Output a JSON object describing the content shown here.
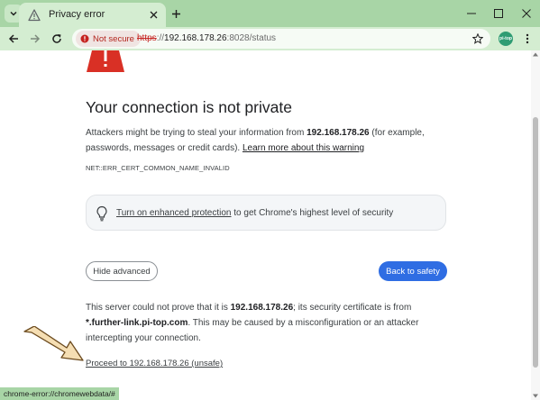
{
  "tab": {
    "title": "Privacy error"
  },
  "omnibox": {
    "security_label": "Not secure",
    "url_scheme": "https",
    "url_sep": "://",
    "url_host": "192.168.178.26",
    "url_rest": ":8028/status"
  },
  "extension": {
    "label": "pi-top"
  },
  "page": {
    "heading": "Your connection is not private",
    "para_a": "Attackers might be trying to steal your information from ",
    "para_host": "192.168.178.26",
    "para_b": " (for example, passwords, messages or credit cards). ",
    "learn_more": "Learn more about this warning",
    "error_code": "NET::ERR_CERT_COMMON_NAME_INVALID",
    "ep_link": "Turn on enhanced protection",
    "ep_rest": " to get Chrome's highest level of security",
    "hide_advanced": "Hide advanced",
    "back_to_safety": "Back to safety",
    "details_a": "This server could not prove that it is ",
    "details_host": "192.168.178.26",
    "details_b": "; its security certificate is from ",
    "details_cert": "*.further-link.pi-top.com",
    "details_c": ". This may be caused by a misconfiguration or an attacker intercepting your connection.",
    "proceed_link": "Proceed to 192.168.178.26 (unsafe)"
  },
  "status_bar": {
    "text": "chrome-error://chromewebdata/#"
  },
  "colors": {
    "chrome_frame": "#a8d5a6",
    "chrome_toolbar": "#d4edd1",
    "warning_red": "#d93025",
    "primary_button": "#2f6de3",
    "annotation_arrow": "#f5deb3"
  },
  "icons": {
    "tab_search": "chevron-down-icon",
    "favicon": "alert-triangle-icon",
    "warning": "warning-triangle-icon",
    "enhanced_protection": "lightbulb-icon"
  }
}
